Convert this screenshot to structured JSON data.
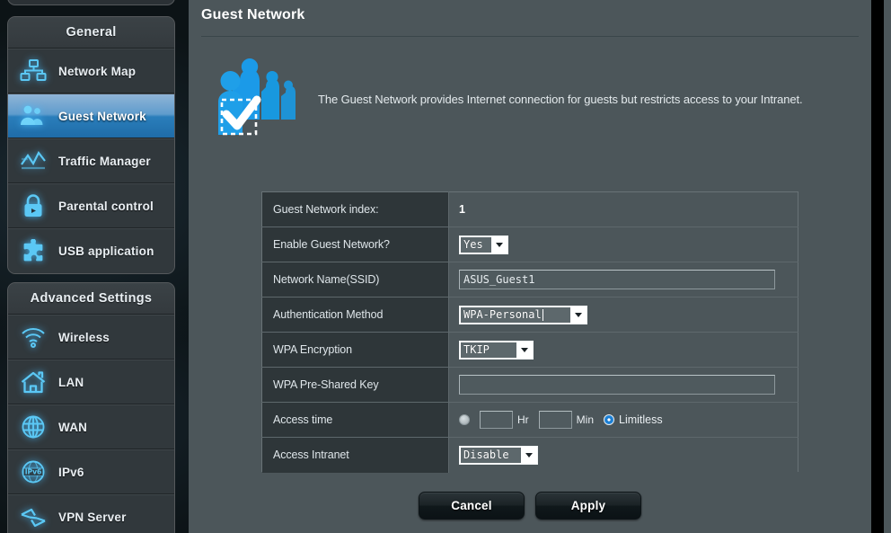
{
  "sidebar": {
    "groups": [
      {
        "title": "General",
        "items": [
          {
            "label": "Network Map",
            "icon": "network-map-icon",
            "active": false
          },
          {
            "label": "Guest Network",
            "icon": "guest-network-icon",
            "active": true
          },
          {
            "label": "Traffic Manager",
            "icon": "traffic-manager-icon",
            "active": false
          },
          {
            "label": "Parental control",
            "icon": "lock-icon",
            "active": false
          },
          {
            "label": "USB application",
            "icon": "puzzle-icon",
            "active": false
          }
        ]
      },
      {
        "title": "Advanced Settings",
        "items": [
          {
            "label": "Wireless",
            "icon": "wifi-icon",
            "active": false
          },
          {
            "label": "LAN",
            "icon": "home-icon",
            "active": false
          },
          {
            "label": "WAN",
            "icon": "globe-icon",
            "active": false
          },
          {
            "label": "IPv6",
            "icon": "ipv6-globe-icon",
            "active": false
          },
          {
            "label": "VPN Server",
            "icon": "vpn-icon",
            "active": false
          }
        ]
      }
    ]
  },
  "main": {
    "title": "Guest Network",
    "description": "The Guest Network provides Internet connection for guests but restricts access to your Intranet.",
    "intro_icon": "guests-checkmark-icon"
  },
  "form": {
    "rows": [
      {
        "label": "Guest Network index:",
        "type": "static",
        "value": "1"
      },
      {
        "label": "Enable Guest Network?",
        "type": "select",
        "value": "Yes"
      },
      {
        "label": "Network Name(SSID)",
        "type": "text",
        "value": "ASUS_Guest1"
      },
      {
        "label": "Authentication Method",
        "type": "select",
        "value": "WPA-Personal"
      },
      {
        "label": "WPA Encryption",
        "type": "select",
        "value": "TKIP"
      },
      {
        "label": "WPA Pre-Shared Key",
        "type": "text",
        "value": ""
      },
      {
        "label": "Access time",
        "type": "accesstime"
      },
      {
        "label": "Access Intranet",
        "type": "select",
        "value": "Disable"
      }
    ],
    "access_time": {
      "hours_value": "",
      "minutes_value": "",
      "hours_unit": "Hr",
      "minutes_unit": "Min",
      "limitless_label": "Limitless",
      "timed_selected": false,
      "limitless_selected": true
    }
  },
  "buttons": {
    "cancel": "Cancel",
    "apply": "Apply"
  },
  "colors": {
    "accent_blue": "#2a7ebb",
    "icon_cyan": "#4fc3f7",
    "panel_bg": "#4c565a",
    "label_bg": "#2e3639"
  }
}
